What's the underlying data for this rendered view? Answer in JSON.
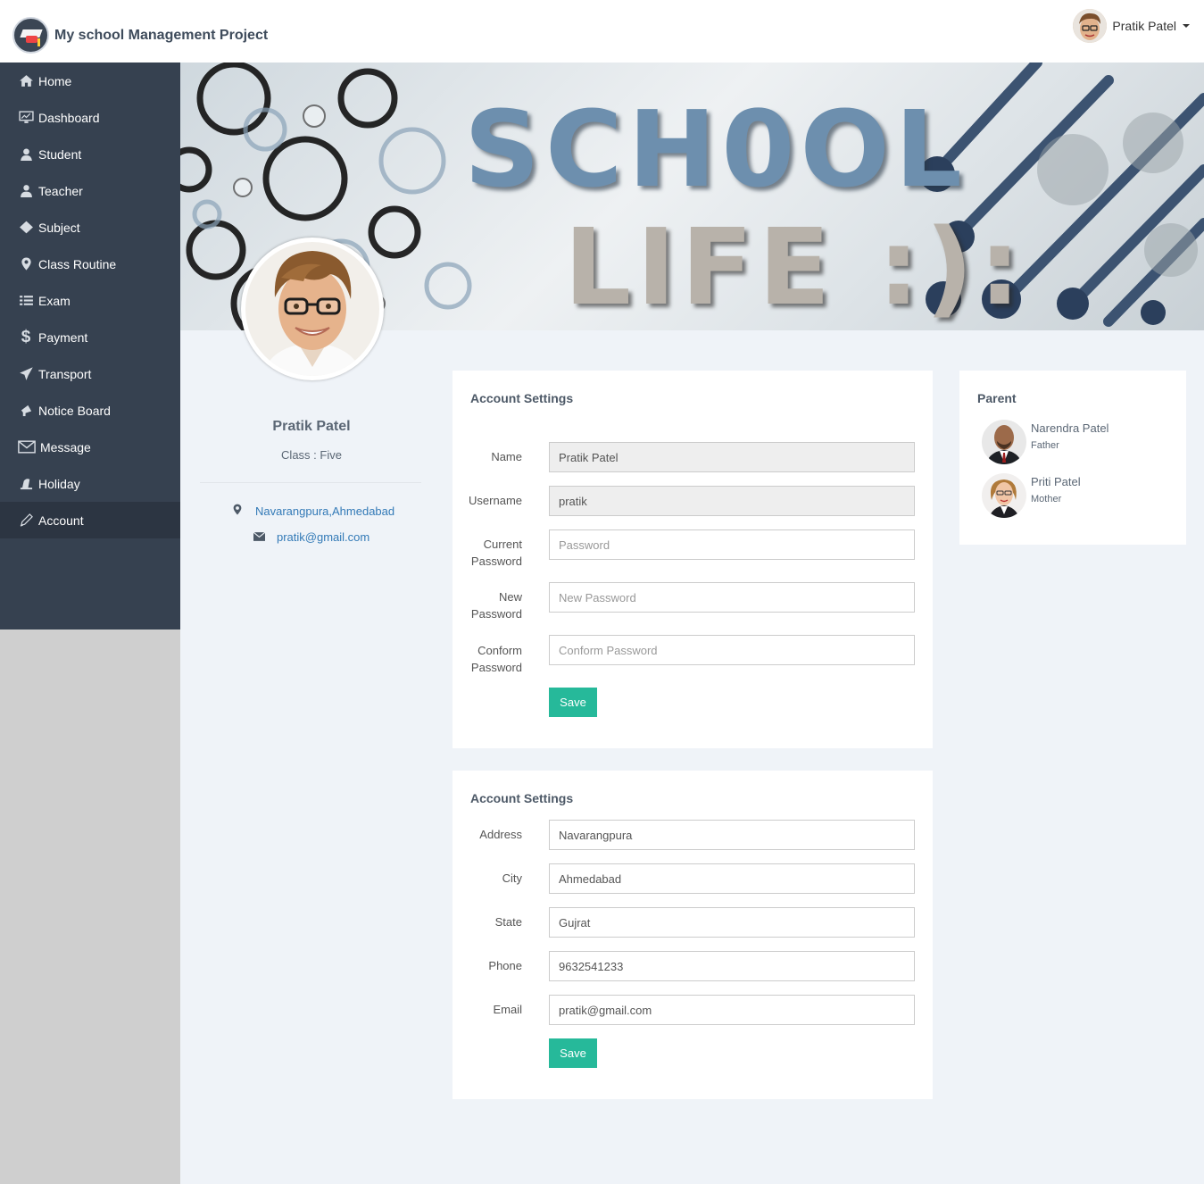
{
  "app": {
    "title": "My school Management Project"
  },
  "user_menu": {
    "name": "Pratik Patel"
  },
  "sidebar": {
    "items": [
      {
        "label": "Home",
        "icon": "home-icon"
      },
      {
        "label": "Dashboard",
        "icon": "desktop-icon"
      },
      {
        "label": "Student",
        "icon": "student-icon"
      },
      {
        "label": "Teacher",
        "icon": "teacher-icon"
      },
      {
        "label": "Subject",
        "icon": "diamond-icon"
      },
      {
        "label": "Class Routine",
        "icon": "map-marker-icon"
      },
      {
        "label": "Exam",
        "icon": "list-icon"
      },
      {
        "label": "Payment",
        "icon": "dollar-icon"
      },
      {
        "label": "Transport",
        "icon": "plane-icon"
      },
      {
        "label": "Notice Board",
        "icon": "bullhorn-icon"
      },
      {
        "label": "Message",
        "icon": "envelope-icon"
      },
      {
        "label": "Holiday",
        "icon": "holiday-icon"
      },
      {
        "label": "Account",
        "icon": "pencil-icon",
        "active": true
      }
    ]
  },
  "banner": {
    "line1": "SCH0OL",
    "line2": "LIFE :):"
  },
  "profile": {
    "name": "Pratik Patel",
    "class_text": "Class : Five",
    "address": "Navarangpura,Ahmedabad",
    "email": "pratik@gmail.com"
  },
  "account_panel": {
    "title": "Account Settings",
    "name_label": "Name",
    "name_value": "Pratik Patel",
    "username_label": "Username",
    "username_value": "pratik",
    "current_password_label_1": "Current",
    "current_password_label_2": "Password",
    "current_password_placeholder": "Password",
    "new_password_label_1": "New",
    "new_password_label_2": "Password",
    "new_password_placeholder": "New Password",
    "confirm_password_label_1": "Conform",
    "confirm_password_label_2": "Password",
    "confirm_password_placeholder": "Conform Password",
    "save_label": "Save"
  },
  "address_panel": {
    "title": "Account Settings",
    "address_label": "Address",
    "address_value": "Navarangpura",
    "city_label": "City",
    "city_value": "Ahmedabad",
    "state_label": "State",
    "state_value": "Gujrat",
    "phone_label": "Phone",
    "phone_value": "9632541233",
    "email_label": "Email",
    "email_value": "pratik@gmail.com",
    "save_label": "Save"
  },
  "parent_panel": {
    "title": "Parent",
    "parents": [
      {
        "name": "Narendra Patel",
        "relation": "Father"
      },
      {
        "name": "Priti Patel",
        "relation": "Mother"
      }
    ]
  },
  "colors": {
    "sidebar": "#364150",
    "sidebar_active": "#2c3542",
    "accent_button": "#26b99a",
    "link": "#337ab7",
    "page_bg": "#eff3f8"
  }
}
